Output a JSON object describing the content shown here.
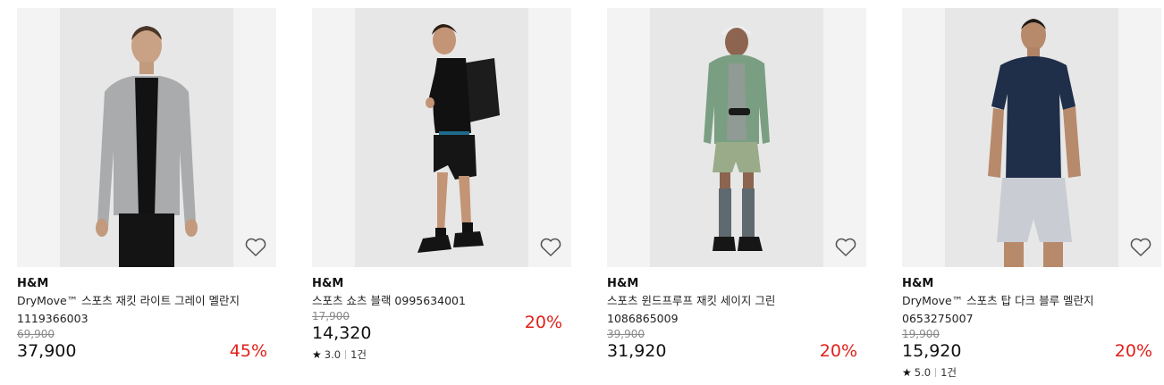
{
  "products": [
    {
      "brand": "H&M",
      "name": "DryMove™ 스포츠 재킷 라이트 그레이 멜란지",
      "code": "1119366003",
      "original_price": "69,900",
      "price": "37,900",
      "discount": "45%",
      "rating": null,
      "image_icon": "gray-jacket-product-photo"
    },
    {
      "brand": "H&M",
      "name": "스포츠 쇼츠 블랙 0995634001",
      "code": "",
      "original_price": "17,900",
      "price": "14,320",
      "discount": "20%",
      "rating": {
        "score": "3.0",
        "count": "1건"
      },
      "image_icon": "black-shorts-product-photo"
    },
    {
      "brand": "H&M",
      "name": "스포츠 윈드프루프 재킷 세이지 그린",
      "code": "1086865009",
      "original_price": "39,900",
      "price": "31,920",
      "discount": "20%",
      "rating": null,
      "image_icon": "green-windbreaker-product-photo"
    },
    {
      "brand": "H&M",
      "name": "DryMove™ 스포츠 탑 다크 블루 멜란지",
      "code": "0653275007",
      "original_price": "19,900",
      "price": "15,920",
      "discount": "20%",
      "rating": {
        "score": "5.0",
        "count": "1건"
      },
      "image_icon": "navy-tshirt-product-photo"
    }
  ],
  "colors": {
    "discount": "#e0201a",
    "image_bg": "#f3f3f3",
    "photo_bg": "#e7e7e7"
  },
  "icons": {
    "wishlist": "heart-outline-icon",
    "rating": "star-icon"
  }
}
